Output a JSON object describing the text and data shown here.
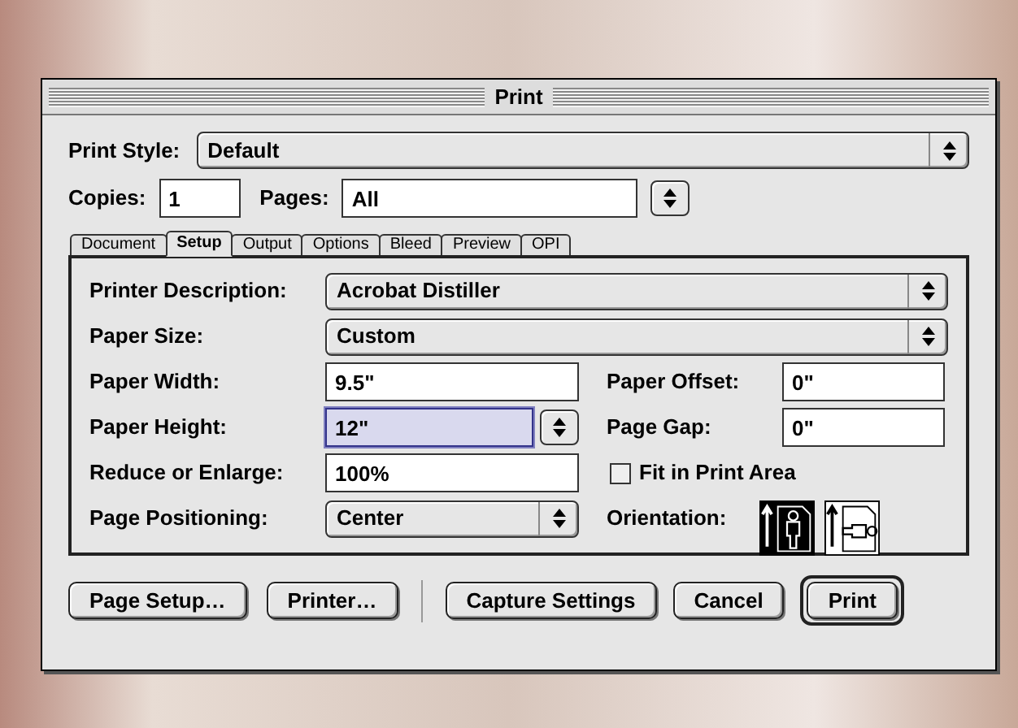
{
  "window": {
    "title": "Print"
  },
  "print_style": {
    "label": "Print Style:",
    "value": "Default"
  },
  "copies": {
    "label": "Copies:",
    "value": "1"
  },
  "pages": {
    "label": "Pages:",
    "value": "All"
  },
  "tabs": [
    {
      "label": "Document",
      "selected": false
    },
    {
      "label": "Setup",
      "selected": true
    },
    {
      "label": "Output",
      "selected": false
    },
    {
      "label": "Options",
      "selected": false
    },
    {
      "label": "Bleed",
      "selected": false
    },
    {
      "label": "Preview",
      "selected": false
    },
    {
      "label": "OPI",
      "selected": false
    }
  ],
  "setup": {
    "printer_description": {
      "label": "Printer Description:",
      "value": "Acrobat Distiller"
    },
    "paper_size": {
      "label": "Paper Size:",
      "value": "Custom"
    },
    "paper_width": {
      "label": "Paper Width:",
      "value": "9.5\""
    },
    "paper_offset": {
      "label": "Paper Offset:",
      "value": "0\""
    },
    "paper_height": {
      "label": "Paper Height:",
      "value": "12\"",
      "focused": true
    },
    "page_gap": {
      "label": "Page Gap:",
      "value": "0\""
    },
    "reduce_or_enlarge": {
      "label": "Reduce or Enlarge:",
      "value": "100%"
    },
    "fit_in_print_area": {
      "label": "Fit in Print Area",
      "checked": false
    },
    "page_positioning": {
      "label": "Page Positioning:",
      "value": "Center"
    },
    "orientation": {
      "label": "Orientation:",
      "options": [
        {
          "kind": "portrait",
          "selected": true
        },
        {
          "kind": "landscape",
          "selected": false
        }
      ]
    }
  },
  "buttons_left": [
    {
      "label": "Page Setup…",
      "default": false
    },
    {
      "label": "Printer…",
      "default": false
    }
  ],
  "buttons_right": [
    {
      "label": "Capture Settings",
      "default": false
    },
    {
      "label": "Cancel",
      "default": false
    },
    {
      "label": "Print",
      "default": true
    }
  ]
}
